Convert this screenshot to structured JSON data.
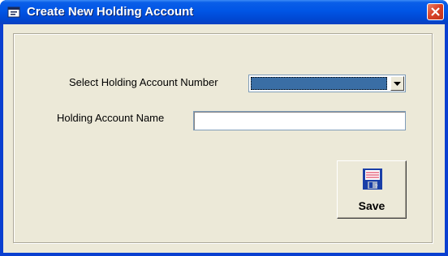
{
  "window": {
    "title": "Create New Holding Account",
    "title_icon": "app-icon",
    "close_icon": "close-icon"
  },
  "form": {
    "account_number_label": "Select Holding Account Number",
    "account_number_value": "",
    "account_name_label": "Holding Account Name",
    "account_name_value": "",
    "save_label": "Save",
    "save_icon": "floppy-disk-icon"
  },
  "colors": {
    "titlebar": "#0055e5",
    "close_button": "#d9432a",
    "dialog_background": "#ece9d8",
    "selected_value_highlight": "#3a6ea5"
  }
}
